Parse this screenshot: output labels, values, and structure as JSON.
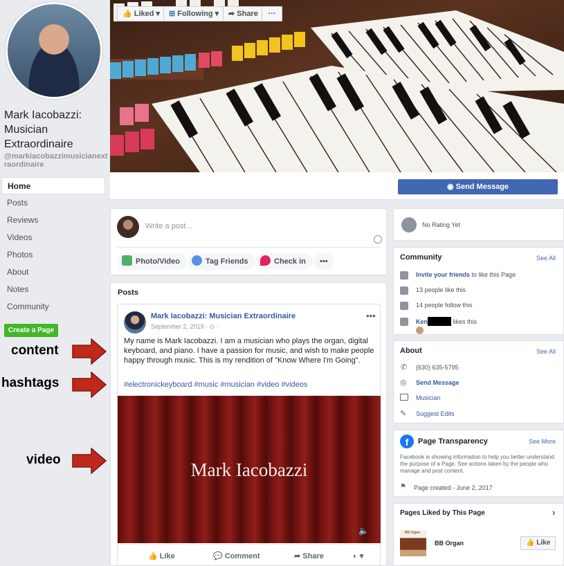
{
  "sidebar": {
    "page_name": "Mark Iacobazzi: Musician Extraordinaire",
    "handle": "@markiacobazzimusicianextraordinaire",
    "nav": [
      "Home",
      "Posts",
      "Reviews",
      "Videos",
      "Photos",
      "About",
      "Notes",
      "Community"
    ],
    "create_page": "Create a Page"
  },
  "annotations": {
    "content": "content",
    "hashtags": "hashtags",
    "video": "video"
  },
  "actions": {
    "liked": "Liked",
    "following": "Following",
    "share": "Share",
    "more": "···",
    "send_message": "Send Message"
  },
  "composer": {
    "placeholder": "Write a post...",
    "photo_video": "Photo/Video",
    "tag_friends": "Tag Friends",
    "check_in": "Check in",
    "more": "•••"
  },
  "posts": {
    "header": "Posts",
    "author": "Mark Iacobazzi: Musician Extraordinaire",
    "date": "September 2, 2019 · ⊙ ·",
    "body": "My name is Mark Iacobazzi. I am a musician who plays the organ, digital keyboard, and piano. I have a passion for music, and wish to make people happy through music. This is my rendition of \"Know Where I'm Going\".",
    "hashtags": "#electronickeyboard #music #musician #video #videos",
    "video_title": "Mark Iacobazzi",
    "like": "Like",
    "comment": "Comment",
    "share": "Share"
  },
  "rating": {
    "text": "No Rating Yet"
  },
  "community": {
    "title": "Community",
    "see_all": "See All",
    "invite_link": "Invite your friends",
    "invite_rest": " to like this Page",
    "likes": "13 people like this",
    "follows": "14 people follow this",
    "friend_name": "Ken",
    "friend_rest": " likes this"
  },
  "about": {
    "title": "About",
    "see_all": "See All",
    "phone": "(630) 635-5795",
    "send_message": "Send Message",
    "category": "Musician",
    "suggest": "Suggest Edits"
  },
  "transparency": {
    "title": "Page Transparency",
    "see_more": "See More",
    "desc": "Facebook is showing information to help you better understand the purpose of a Page. See actions taken by the people who manage and post content.",
    "created": "Page created - June 2, 2017"
  },
  "pages_liked": {
    "title": "Pages Liked by This Page",
    "page": "BB Organ",
    "thumb_label": "BB Organ",
    "like": "Like"
  },
  "colors": {
    "fb_blue": "#4267b2",
    "green": "#42b72a",
    "arrow_red": "#c0281c"
  }
}
